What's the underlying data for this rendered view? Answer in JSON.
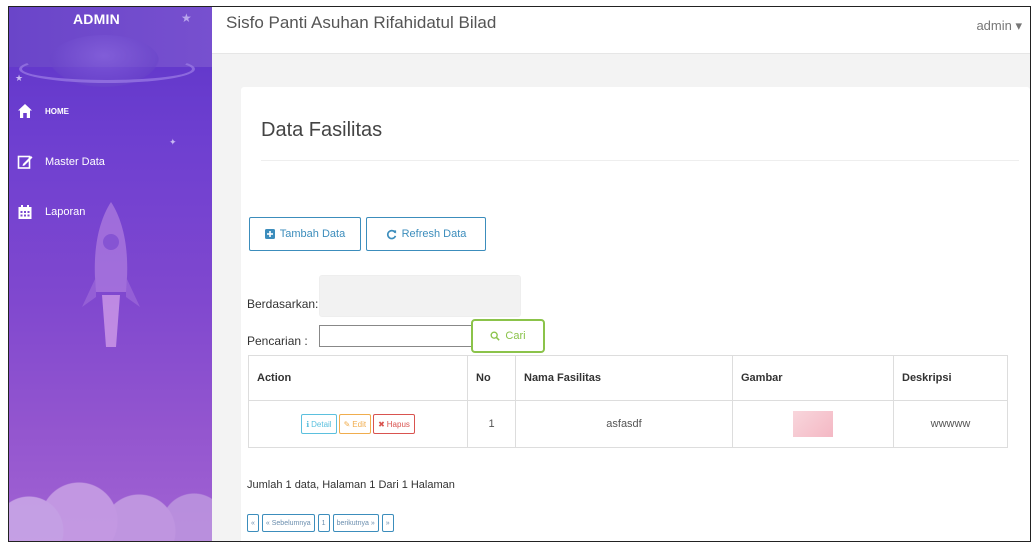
{
  "sidebar": {
    "brand": "ADMIN",
    "items": [
      {
        "label": "HOME",
        "icon": "home-icon"
      },
      {
        "label": "Master Data",
        "icon": "edit-icon"
      },
      {
        "label": "Laporan",
        "icon": "calendar-icon"
      }
    ]
  },
  "header": {
    "title": "Sisfo Panti Asuhan Rifahidatul Bilad",
    "user": "admin ▾"
  },
  "main": {
    "page_title": "Data Fasilitas",
    "buttons": {
      "tambah": "Tambah Data",
      "refresh": "Refresh Data"
    },
    "filter": {
      "berdasarkan_label": "Berdasarkan:",
      "pencarian_label": "Pencarian :",
      "search_value": "",
      "search_button": "Cari"
    },
    "table": {
      "headers": [
        "Action",
        "No",
        "Nama Fasilitas",
        "Gambar",
        "Deskripsi"
      ],
      "rows": [
        {
          "actions": [
            "Detail",
            "Edit",
            "Hapus"
          ],
          "no": "1",
          "nama": "asfasdf",
          "deskripsi": "wwwww"
        }
      ]
    },
    "summary": "Jumlah 1 data, Halaman 1 Dari 1 Halaman",
    "pagination": [
      "«",
      "« Sebelumnya",
      "1",
      "berikutnya »",
      "»"
    ]
  },
  "colors": {
    "sidebar": "#6e3fd0",
    "primary": "#3c8dbc",
    "success": "#8bc34a",
    "info": "#5bc0de",
    "warning": "#f0ad4e",
    "danger": "#d9534f"
  }
}
